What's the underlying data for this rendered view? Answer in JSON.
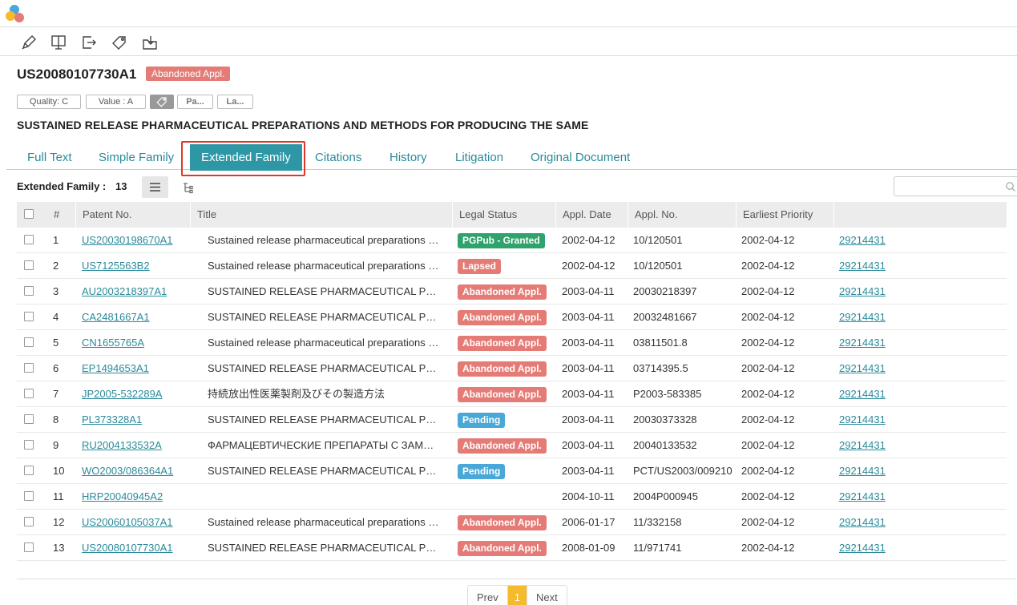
{
  "patent": {
    "number": "US20080107730A1",
    "status": "Abandoned Appl.",
    "status_color": "#e57b76",
    "title": "SUSTAINED RELEASE PHARMACEUTICAL PREPARATIONS AND METHODS FOR PRODUCING THE SAME"
  },
  "chips": {
    "quality": "Quality: C",
    "value": "Value : A",
    "chip3": "Pa...",
    "chip4": "La..."
  },
  "tabs": [
    "Full Text",
    "Simple Family",
    "Extended Family",
    "Citations",
    "History",
    "Litigation",
    "Original Document"
  ],
  "active_tab": "Extended Family",
  "family": {
    "label": "Extended Family :",
    "count": "13"
  },
  "columns": [
    "#",
    "Patent No.",
    "Title",
    "Legal Status",
    "Appl. Date",
    "Appl. No.",
    "Earliest Priority"
  ],
  "rows": [
    {
      "num": "1",
      "patent": "US20030198670A1",
      "title": "Sustained release pharmaceutical preparations and methods for producing the same",
      "status": "PGPub - Granted",
      "status_color": "#2fa36b",
      "appl_date": "2002-04-12",
      "appl_no": "10/120501",
      "priority": "2002-04-12",
      "family_id": "29214431"
    },
    {
      "num": "2",
      "patent": "US7125563B2",
      "title": "Sustained release pharmaceutical preparations and methods for producing the same",
      "status": "Lapsed",
      "status_color": "#e57b76",
      "appl_date": "2002-04-12",
      "appl_no": "10/120501",
      "priority": "2002-04-12",
      "family_id": "29214431"
    },
    {
      "num": "3",
      "patent": "AU2003218397A1",
      "title": "SUSTAINED RELEASE PHARMACEUTICAL PREPARATIONS AND METHODS",
      "status": "Abandoned Appl.",
      "status_color": "#e57b76",
      "appl_date": "2003-04-11",
      "appl_no": "20030218397",
      "priority": "2002-04-12",
      "family_id": "29214431"
    },
    {
      "num": "4",
      "patent": "CA2481667A1",
      "title": "SUSTAINED RELEASE PHARMACEUTICAL PREPARATIONS AND METHODS",
      "status": "Abandoned Appl.",
      "status_color": "#e57b76",
      "appl_date": "2003-04-11",
      "appl_no": "20032481667",
      "priority": "2002-04-12",
      "family_id": "29214431"
    },
    {
      "num": "5",
      "patent": "CN1655765A",
      "title": "Sustained release pharmaceutical preparations and methods for producing the same",
      "status": "Abandoned Appl.",
      "status_color": "#e57b76",
      "appl_date": "2003-04-11",
      "appl_no": "03811501.8",
      "priority": "2002-04-12",
      "family_id": "29214431"
    },
    {
      "num": "6",
      "patent": "EP1494653A1",
      "title": "SUSTAINED RELEASE PHARMACEUTICAL PREPARATIONS AND METHODS",
      "status": "Abandoned Appl.",
      "status_color": "#e57b76",
      "appl_date": "2003-04-11",
      "appl_no": "03714395.5",
      "priority": "2002-04-12",
      "family_id": "29214431"
    },
    {
      "num": "7",
      "patent": "JP2005-532289A",
      "title": "持続放出性医薬製剤及びその製造方法",
      "status": "Abandoned Appl.",
      "status_color": "#e57b76",
      "appl_date": "2003-04-11",
      "appl_no": "P2003-583385",
      "priority": "2002-04-12",
      "family_id": "29214431"
    },
    {
      "num": "8",
      "patent": "PL373328A1",
      "title": "SUSTAINED RELEASE PHARMACEUTICAL PREPARATIONS AND METHODS",
      "status": "Pending",
      "status_color": "#4aa8d8",
      "appl_date": "2003-04-11",
      "appl_no": "20030373328",
      "priority": "2002-04-12",
      "family_id": "29214431"
    },
    {
      "num": "9",
      "patent": "RU2004133532A",
      "title": "ФАРМАЦЕВТИЧЕСКИЕ ПРЕПАРАТЫ С ЗАМЕДЛЕННЫМ ВЫСВОБОЖДЕНИЕМ",
      "status": "Abandoned Appl.",
      "status_color": "#e57b76",
      "appl_date": "2003-04-11",
      "appl_no": "20040133532",
      "priority": "2002-04-12",
      "family_id": "29214431"
    },
    {
      "num": "10",
      "patent": "WO2003/086364A1",
      "title": "SUSTAINED RELEASE PHARMACEUTICAL PREPARATIONS AND METHODS",
      "status": "Pending",
      "status_color": "#4aa8d8",
      "appl_date": "2003-04-11",
      "appl_no": "PCT/US2003/009210",
      "priority": "2002-04-12",
      "family_id": "29214431"
    },
    {
      "num": "11",
      "patent": "HRP20040945A2",
      "title": "",
      "status": "",
      "status_color": "",
      "appl_date": "2004-10-11",
      "appl_no": "2004P000945",
      "priority": "2002-04-12",
      "family_id": "29214431"
    },
    {
      "num": "12",
      "patent": "US20060105037A1",
      "title": "Sustained release pharmaceutical preparations and methods for producing the same",
      "status": "Abandoned Appl.",
      "status_color": "#e57b76",
      "appl_date": "2006-01-17",
      "appl_no": "11/332158",
      "priority": "2002-04-12",
      "family_id": "29214431"
    },
    {
      "num": "13",
      "patent": "US20080107730A1",
      "title": "SUSTAINED RELEASE PHARMACEUTICAL PREPARATIONS AND METHODS",
      "status": "Abandoned Appl.",
      "status_color": "#e57b76",
      "appl_date": "2008-01-09",
      "appl_no": "11/971741",
      "priority": "2002-04-12",
      "family_id": "29214431"
    }
  ],
  "pager": {
    "prev": "Prev",
    "current": "1",
    "next": "Next"
  },
  "toolbar_icons": [
    "pen-icon",
    "monitor-icon",
    "export-icon",
    "tag-icon",
    "download-box-icon"
  ]
}
